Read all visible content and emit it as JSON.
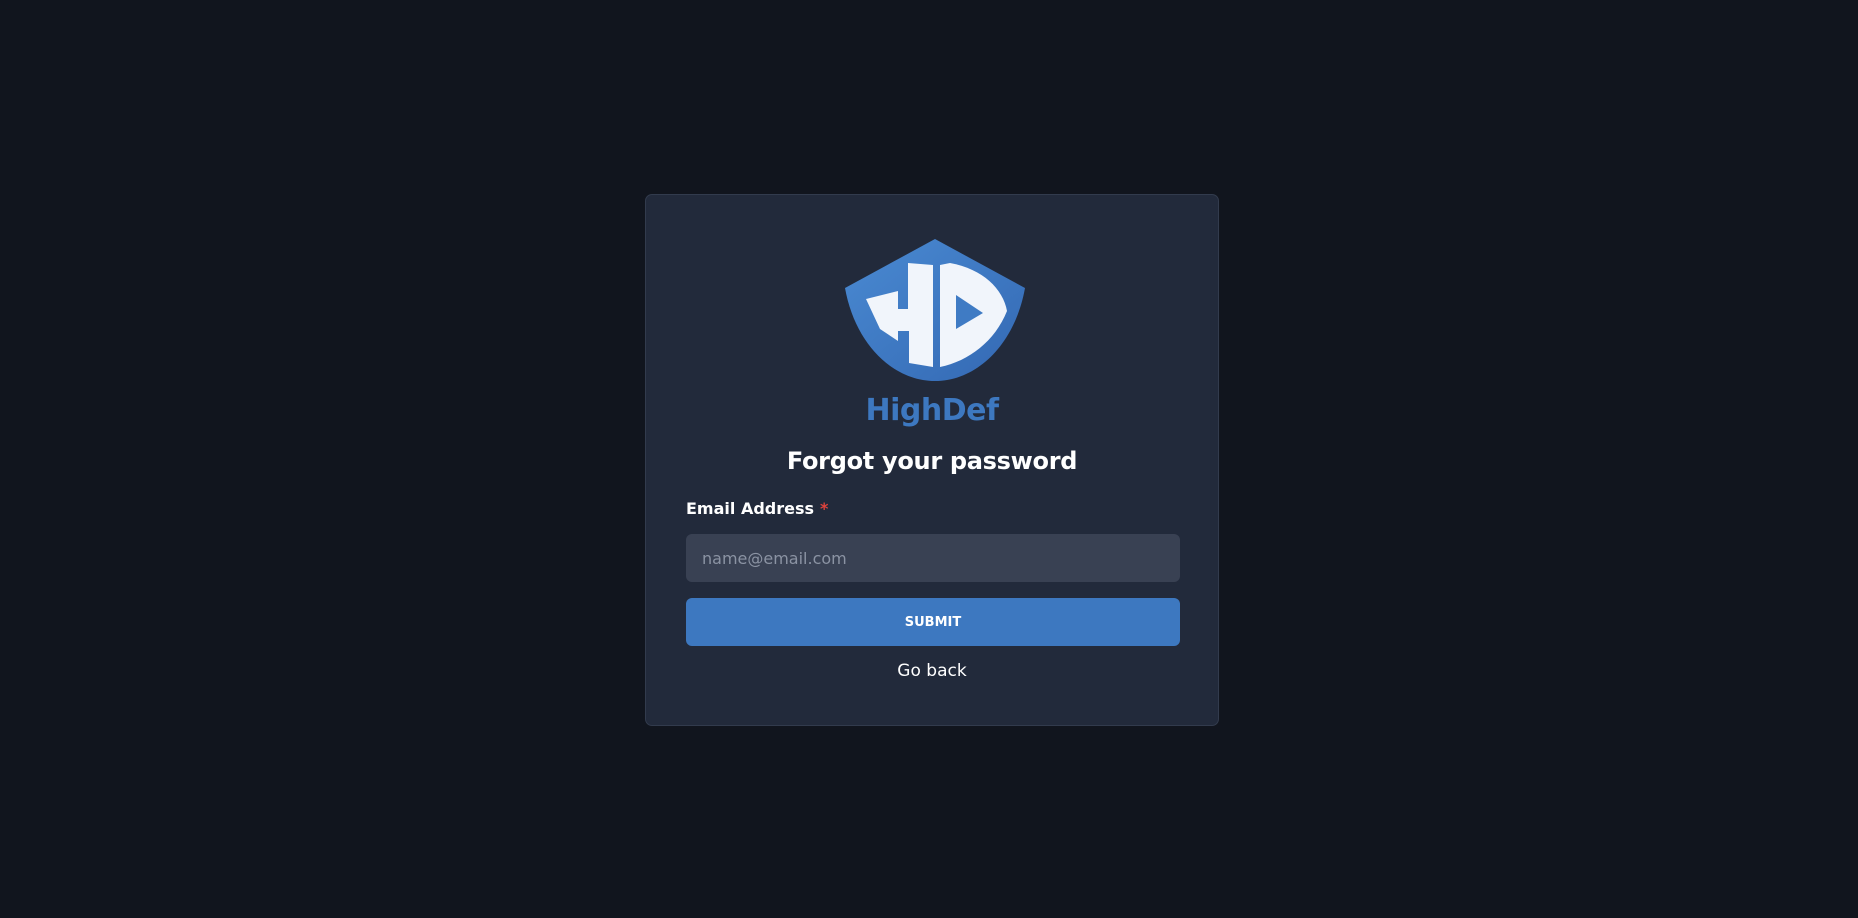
{
  "brand": {
    "name": "HighDef",
    "logo_icon": "hd-shield-logo",
    "color": "#3d78c0"
  },
  "form": {
    "title": "Forgot your password",
    "email_label": "Email Address",
    "required_mark": "*",
    "email_placeholder": "name@email.com",
    "email_value": "",
    "submit_label": "SUBMIT",
    "go_back_label": "Go back"
  },
  "colors": {
    "background": "#11151e",
    "card": "#222a3b",
    "input": "#394153",
    "accent": "#3d78c0",
    "required": "#e0433c"
  }
}
